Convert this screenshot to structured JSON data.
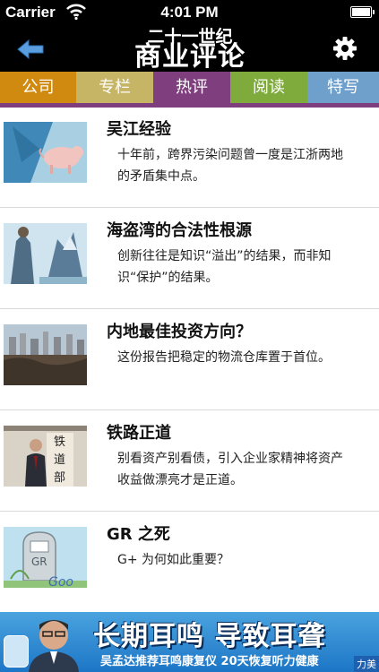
{
  "status_bar": {
    "carrier": "Carrier",
    "time": "4:01 PM"
  },
  "nav": {
    "logo_top": "二十一世纪",
    "logo_bottom": "商业评论"
  },
  "tabs": [
    {
      "label": "公司",
      "color": "#d08a10"
    },
    {
      "label": "专栏",
      "color": "#c7b566"
    },
    {
      "label": "热评",
      "color": "#7f3f7e",
      "selected": true
    },
    {
      "label": "阅读",
      "color": "#7fab3c"
    },
    {
      "label": "特写",
      "color": "#6f9fcb"
    }
  ],
  "articles": [
    {
      "title": "吴江经验",
      "desc": "十年前，跨界污染问题曾一度是江浙两地的矛盾集中点。",
      "thumb": "pig-illustration"
    },
    {
      "title": "海盗湾的合法性根源",
      "desc": "创新往往是知识“溢出”的结果，而非知识“保护”的结果。",
      "thumb": "pirate-illustration"
    },
    {
      "title": "内地最佳投资方向？",
      "desc": "这份报告把稳定的物流仓库置于首位。",
      "thumb": "construction-photo"
    },
    {
      "title": "铁路正道",
      "desc": "别看资产别看债，引入企业家精神将资产收益做漂亮才是正道。",
      "thumb": "railway-ministry-photo",
      "thumb_text": [
        "铁",
        "道",
        "部"
      ]
    },
    {
      "title": "GR 之死",
      "desc": "G+ 为何如此重要？",
      "thumb": "gravestone-illustration",
      "thumb_text": [
        "GR",
        "Goo"
      ]
    }
  ],
  "ad": {
    "headline": "长期耳鸣  导致耳聋",
    "sub": "吴孟达推荐耳鸣康复仪  20天恢复听力健康",
    "tag": "力美"
  }
}
